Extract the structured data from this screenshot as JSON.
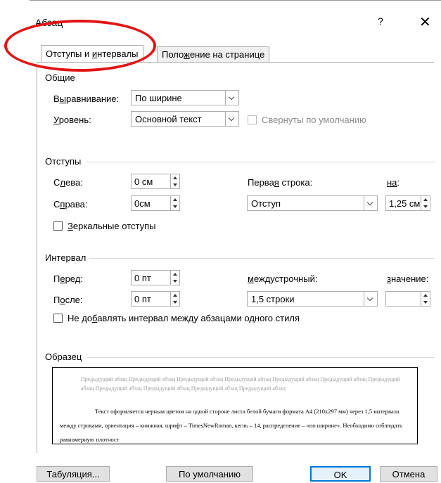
{
  "dialog": {
    "title": "Абзац",
    "help": "?",
    "close": "✕"
  },
  "tabs": [
    {
      "pre": "Отступы и ",
      "u": "и",
      "post": "нтервалы",
      "active": true
    },
    {
      "pre": "Поло",
      "u": "ж",
      "post": "ение на странице",
      "active": false
    }
  ],
  "general": {
    "section": "Общие",
    "alignment_label": {
      "pre": "В",
      "u": "ы",
      "post": "равнивание:"
    },
    "alignment_value": "По ширине",
    "level_label": {
      "pre": "",
      "u": "У",
      "post": "ровень:"
    },
    "level_value": "Основной текст",
    "collapsed_label": "Свернуты по умолчанию"
  },
  "indents": {
    "section": "Отступы",
    "left_label": {
      "pre": "С",
      "u": "л",
      "post": "ева:"
    },
    "left_value": "0 см",
    "right_label": {
      "pre": "С",
      "u": "п",
      "post": "рава:"
    },
    "right_value": "0см",
    "first_line_label": {
      "pre": "Перва",
      "u": "я",
      "post": " строка:"
    },
    "first_line_value": "Отступ",
    "by_label": {
      "pre": "",
      "u": "на",
      "post": ":"
    },
    "by_value": "1,25 см",
    "mirror_label": {
      "pre": "",
      "u": "З",
      "post": "еркальные отступы"
    }
  },
  "spacing": {
    "section": "Интервал",
    "before_label": {
      "pre": "П",
      "u": "е",
      "post": "ред:"
    },
    "before_value": "0 пт",
    "after_label": {
      "pre": "П",
      "u": "о",
      "post": "сле:"
    },
    "after_value": "0 пт",
    "line_label": {
      "pre": "",
      "u": "м",
      "post": "еждустрочный:"
    },
    "line_value": "1,5 строки",
    "value_label": {
      "pre": "",
      "u": "з",
      "post": "начение:"
    },
    "value_value": "",
    "dont_add_label": {
      "pre": "Не до",
      "u": "б",
      "post": "авлять интервал между абзацами одного стиля"
    }
  },
  "preview": {
    "section": "Образец",
    "previous_text": "Предыдущий абзац Предыдущий абзац Предыдущий абзац Предыдущий абзац Предыдущий абзац Предыдущий абзац Предыдущий абзац Предыдущий абзац Предыдущий абзац Предыдущий абзац Предыдущий абзац",
    "sample_text": "Текст оформляется черным цветом на одной стороне листа белой бумаги формата А4 (210х297 мм) через 1,5 интервала между строками, ориентация – книжная, шрифт – TimesNewRoman, кегль – 14, распределение – «по ширине». Необходимо соблюдать равномерную плотност"
  },
  "buttons": {
    "tabs": "Табуляция...",
    "default": "По умолчанию",
    "ok": "OK",
    "cancel": "Отмена"
  },
  "colors": {
    "highlight": "#e01515",
    "ok_border": "#0078d7"
  }
}
